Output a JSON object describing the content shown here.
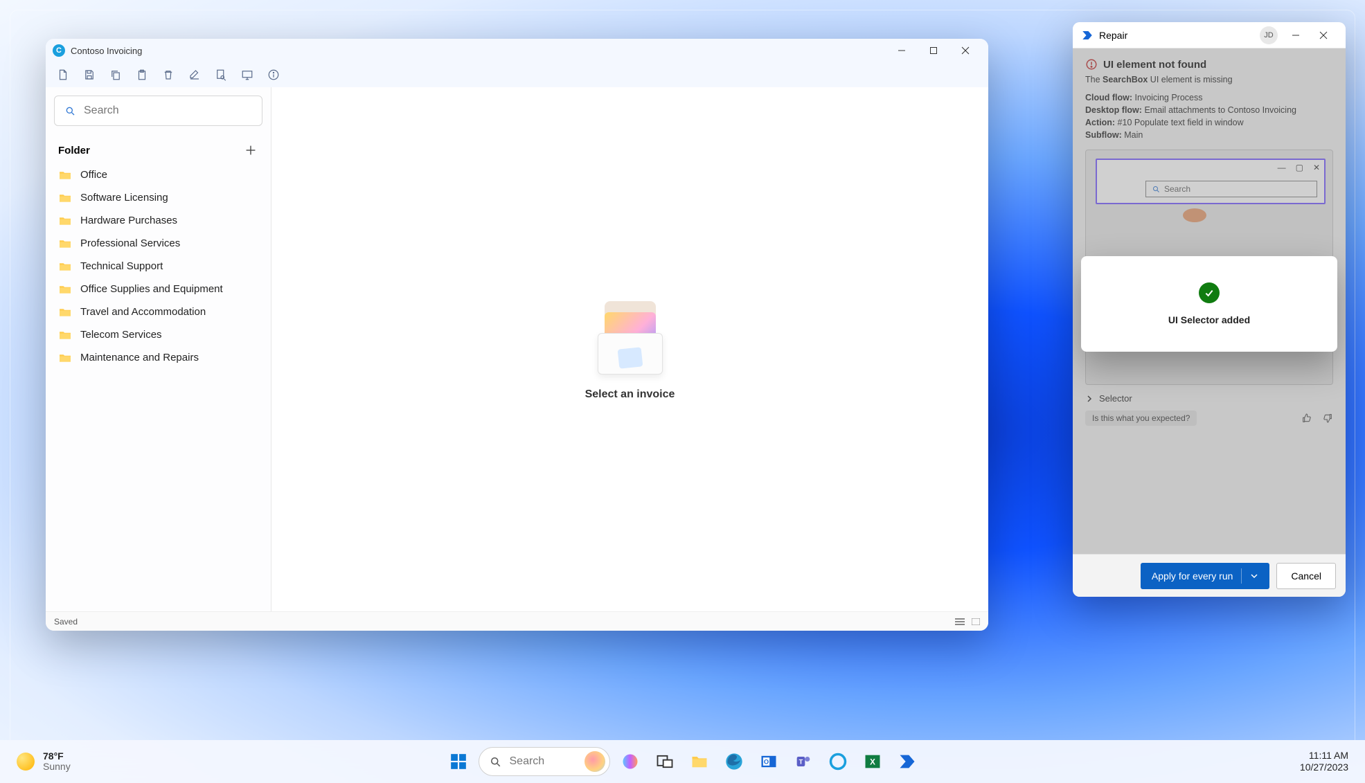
{
  "app": {
    "title": "Contoso Invoicing",
    "search_placeholder": "Search",
    "folder_header": "Folder",
    "folders": [
      "Office",
      "Software Licensing",
      "Hardware Purchases",
      "Professional Services",
      "Technical Support",
      "Office Supplies and Equipment",
      "Travel and Accommodation",
      "Telecom Services",
      "Maintenance and Repairs"
    ],
    "empty_state": "Select an invoice",
    "status": "Saved"
  },
  "repair": {
    "title": "Repair",
    "avatar": "JD",
    "error_title": "UI element not found",
    "error_desc_pre": "The ",
    "error_desc_bold": "SearchBox",
    "error_desc_post": " UI element is missing",
    "cloud_flow_label": "Cloud flow:",
    "cloud_flow_value": "Invoicing Process",
    "desktop_flow_label": "Desktop flow:",
    "desktop_flow_value": "Email attachments to Contoso Invoicing",
    "action_label": "Action:",
    "action_value": "#10 Populate text field in window",
    "subflow_label": "Subflow:",
    "subflow_value": "Main",
    "preview_search_placeholder": "Search",
    "selector_label": "Selector",
    "feedback_question": "Is this what you expected?",
    "apply_button": "Apply for every run",
    "cancel_button": "Cancel",
    "toast_message": "UI Selector added"
  },
  "taskbar": {
    "temp": "78°F",
    "condition": "Sunny",
    "search_placeholder": "Search",
    "time": "11:11 AM",
    "date": "10/27/2023"
  }
}
